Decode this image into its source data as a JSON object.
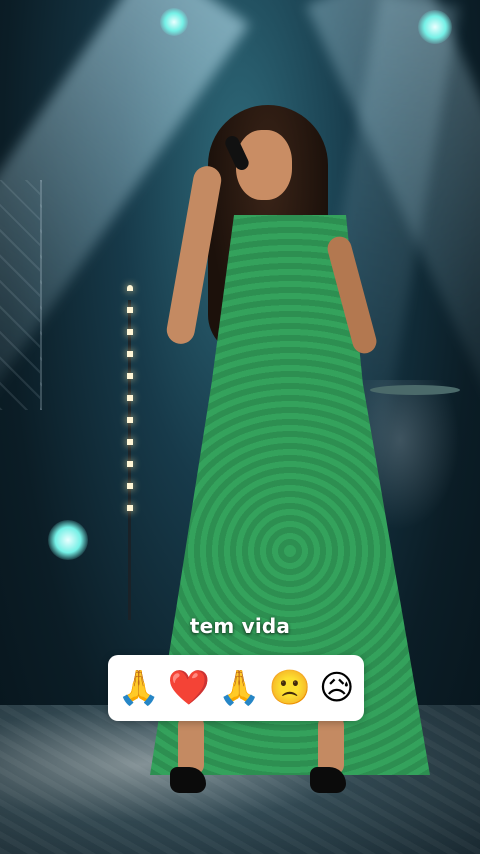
{
  "caption": {
    "text": "tem vida"
  },
  "reaction_bar": {
    "emojis": [
      "🙏",
      "❤️",
      "🙏",
      "🙁",
      "😥"
    ]
  },
  "colors": {
    "dress_green": "#34a25c",
    "stage_teal": "#2f6a7a",
    "spotlight": "#74f0e6",
    "caption_white": "#ffffff"
  }
}
